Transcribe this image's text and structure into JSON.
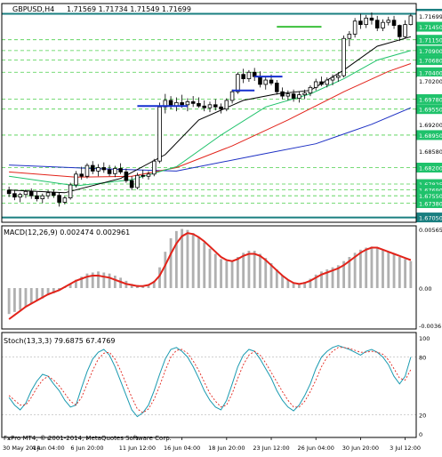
{
  "chart_data": {
    "type": "candlestick",
    "header": {
      "symbol": "GBPUSD,H4",
      "ohlc": "1.71569 1.71734 1.71549 1.71699"
    },
    "price_panel": {
      "ylim": [
        1.67,
        1.718
      ],
      "price_tags": [
        {
          "value": 1.7175,
          "label": "1.71750",
          "style": "teal"
        },
        {
          "value": 1.717,
          "label": "1.71699",
          "style": "current"
        },
        {
          "value": 1.7145,
          "label": "1.71450",
          "style": "green"
        },
        {
          "value": 1.7115,
          "label": "1.71150",
          "style": "green"
        },
        {
          "value": 1.709,
          "label": "1.70900",
          "style": "green"
        },
        {
          "value": 1.7068,
          "label": "1.70680",
          "style": "green"
        },
        {
          "value": 1.704,
          "label": "1.70400",
          "style": "green"
        },
        {
          "value": 1.702,
          "label": "1.70200",
          "style": "plain"
        },
        {
          "value": 1.6978,
          "label": "1.69780",
          "style": "green"
        },
        {
          "value": 1.6955,
          "label": "1.69550",
          "style": "green"
        },
        {
          "value": 1.692,
          "label": "1.69200",
          "style": "plain"
        },
        {
          "value": 1.6895,
          "label": "1.68950",
          "style": "green"
        },
        {
          "value": 1.6858,
          "label": "1.68580",
          "style": "plain"
        },
        {
          "value": 1.682,
          "label": "1.68200",
          "style": "green"
        },
        {
          "value": 1.6782,
          "label": "1.67825",
          "style": "green"
        },
        {
          "value": 1.6769,
          "label": "1.67690",
          "style": "green"
        },
        {
          "value": 1.6755,
          "label": "1.67550",
          "style": "green"
        },
        {
          "value": 1.6738,
          "label": "1.67380",
          "style": "green"
        },
        {
          "value": 1.6705,
          "label": "1.67050",
          "style": "teal"
        }
      ],
      "candles": [
        [
          1.6768,
          1.6776,
          1.6752,
          1.676
        ],
        [
          1.676,
          1.6768,
          1.6745,
          1.6752
        ],
        [
          1.6752,
          1.6762,
          1.674,
          1.6758
        ],
        [
          1.6758,
          1.677,
          1.675,
          1.6765
        ],
        [
          1.6765,
          1.6772,
          1.6748,
          1.6755
        ],
        [
          1.6755,
          1.6764,
          1.6742,
          1.6748
        ],
        [
          1.6748,
          1.676,
          1.6738,
          1.6755
        ],
        [
          1.6755,
          1.6768,
          1.6748,
          1.6762
        ],
        [
          1.6762,
          1.677,
          1.675,
          1.6756
        ],
        [
          1.6756,
          1.6762,
          1.673,
          1.674
        ],
        [
          1.674,
          1.6754,
          1.6735,
          1.675
        ],
        [
          1.675,
          1.6785,
          1.6746,
          1.678
        ],
        [
          1.678,
          1.6812,
          1.6774,
          1.6805
        ],
        [
          1.6805,
          1.6822,
          1.6792,
          1.68
        ],
        [
          1.68,
          1.683,
          1.6795,
          1.6825
        ],
        [
          1.6825,
          1.6835,
          1.6805,
          1.6812
        ],
        [
          1.6812,
          1.6828,
          1.68,
          1.682
        ],
        [
          1.682,
          1.6832,
          1.6808,
          1.6815
        ],
        [
          1.6815,
          1.6826,
          1.68,
          1.6806
        ],
        [
          1.6806,
          1.6824,
          1.6798,
          1.6818
        ],
        [
          1.6818,
          1.683,
          1.6805,
          1.681
        ],
        [
          1.681,
          1.6818,
          1.6785,
          1.679
        ],
        [
          1.679,
          1.68,
          1.6768,
          1.6774
        ],
        [
          1.6774,
          1.6808,
          1.677,
          1.6802
        ],
        [
          1.6802,
          1.6815,
          1.6795,
          1.68
        ],
        [
          1.68,
          1.6812,
          1.6792,
          1.6805
        ],
        [
          1.6805,
          1.684,
          1.68,
          1.6835
        ],
        [
          1.6835,
          1.697,
          1.683,
          1.696
        ],
        [
          1.696,
          1.699,
          1.6945,
          1.6975
        ],
        [
          1.6975,
          1.6985,
          1.6955,
          1.6962
        ],
        [
          1.6962,
          1.6982,
          1.695,
          1.697
        ],
        [
          1.697,
          1.6988,
          1.6958,
          1.6965
        ],
        [
          1.6965,
          1.698,
          1.695,
          1.6972
        ],
        [
          1.6972,
          1.6985,
          1.696,
          1.6968
        ],
        [
          1.6968,
          1.6982,
          1.6958,
          1.6962
        ],
        [
          1.6962,
          1.6975,
          1.695,
          1.6958
        ],
        [
          1.6958,
          1.6972,
          1.6948,
          1.6965
        ],
        [
          1.6965,
          1.6978,
          1.6952,
          1.696
        ],
        [
          1.696,
          1.6968,
          1.6945,
          1.6955
        ],
        [
          1.6955,
          1.698,
          1.695,
          1.6975
        ],
        [
          1.6975,
          1.7,
          1.6968,
          1.6995
        ],
        [
          1.6995,
          1.704,
          1.699,
          1.7035
        ],
        [
          1.7035,
          1.7048,
          1.7015,
          1.7025
        ],
        [
          1.7025,
          1.7045,
          1.7018,
          1.704
        ],
        [
          1.704,
          1.705,
          1.702,
          1.703
        ],
        [
          1.703,
          1.7042,
          1.7005,
          1.7012
        ],
        [
          1.7012,
          1.703,
          1.7,
          1.7022
        ],
        [
          1.7022,
          1.7035,
          1.701,
          1.7015
        ],
        [
          1.7015,
          1.7022,
          1.6988,
          1.6995
        ],
        [
          1.6995,
          1.7005,
          1.6978,
          1.6985
        ],
        [
          1.6985,
          1.6998,
          1.6975,
          1.699
        ],
        [
          1.699,
          1.7,
          1.6972,
          1.698
        ],
        [
          1.698,
          1.6995,
          1.697,
          1.6988
        ],
        [
          1.6988,
          1.7,
          1.6978,
          1.6992
        ],
        [
          1.6992,
          1.701,
          1.6985,
          1.7005
        ],
        [
          1.7005,
          1.7025,
          1.6998,
          1.7018
        ],
        [
          1.7018,
          1.703,
          1.7008,
          1.7012
        ],
        [
          1.7012,
          1.7028,
          1.7005,
          1.7022
        ],
        [
          1.7022,
          1.7035,
          1.701,
          1.7028
        ],
        [
          1.7028,
          1.704,
          1.7018,
          1.7032
        ],
        [
          1.7032,
          1.7125,
          1.7028,
          1.7118
        ],
        [
          1.7118,
          1.7135,
          1.71,
          1.7128
        ],
        [
          1.7128,
          1.7165,
          1.712,
          1.7158
        ],
        [
          1.7158,
          1.7175,
          1.714,
          1.715
        ],
        [
          1.715,
          1.7172,
          1.7142,
          1.7165
        ],
        [
          1.7165,
          1.7178,
          1.715,
          1.716
        ],
        [
          1.716,
          1.717,
          1.7135,
          1.7142
        ],
        [
          1.7142,
          1.7162,
          1.7135,
          1.7155
        ],
        [
          1.7155,
          1.7168,
          1.7148,
          1.716
        ],
        [
          1.716,
          1.717,
          1.714,
          1.7148
        ],
        [
          1.7148,
          1.715,
          1.7112,
          1.7122
        ],
        [
          1.7122,
          1.716,
          1.7118,
          1.715
        ],
        [
          1.715,
          1.7175,
          1.7148,
          1.717
        ]
      ],
      "moving_averages": [
        {
          "color": "#1c2fc4",
          "points": [
            [
              0,
              1.6826
            ],
            [
              15,
              1.6818
            ],
            [
              30,
              1.6812
            ],
            [
              45,
              1.685
            ],
            [
              55,
              1.6875
            ],
            [
              65,
              1.692
            ],
            [
              72,
              1.6958
            ]
          ]
        },
        {
          "color": "#e2231a",
          "points": [
            [
              0,
              1.681
            ],
            [
              12,
              1.6798
            ],
            [
              22,
              1.68
            ],
            [
              30,
              1.682
            ],
            [
              40,
              1.687
            ],
            [
              50,
              1.693
            ],
            [
              60,
              1.6995
            ],
            [
              68,
              1.7042
            ],
            [
              72,
              1.706
            ]
          ]
        },
        {
          "color": "#1fc26b",
          "points": [
            [
              0,
              1.68
            ],
            [
              12,
              1.6778
            ],
            [
              22,
              1.6792
            ],
            [
              30,
              1.6822
            ],
            [
              38,
              1.6895
            ],
            [
              46,
              1.696
            ],
            [
              54,
              1.699
            ],
            [
              60,
              1.7025
            ],
            [
              66,
              1.7068
            ],
            [
              72,
              1.709
            ]
          ]
        },
        {
          "color": "#000000",
          "points": [
            [
              0,
              1.6768
            ],
            [
              10,
              1.6762
            ],
            [
              20,
              1.6795
            ],
            [
              28,
              1.685
            ],
            [
              34,
              1.693
            ],
            [
              42,
              1.6975
            ],
            [
              48,
              1.699
            ],
            [
              54,
              1.6998
            ],
            [
              60,
              1.7045
            ],
            [
              66,
              1.71
            ],
            [
              72,
              1.7122
            ]
          ]
        }
      ],
      "levels": [
        {
          "value": 1.6962,
          "from": 23,
          "to": 32,
          "color": "#1530d0"
        },
        {
          "value": 1.6998,
          "from": 40,
          "to": 44,
          "color": "#1530d0"
        },
        {
          "value": 1.703,
          "from": 44,
          "to": 49,
          "color": "#1530d0"
        },
        {
          "value": 1.7145,
          "from": 48,
          "to": 56,
          "color": "#3cc03c"
        }
      ],
      "dashed_levels": [
        1.7115,
        1.709,
        1.7068,
        1.704,
        1.6978,
        1.6955,
        1.6895,
        1.682,
        1.6782,
        1.6769,
        1.6755,
        1.6738
      ]
    },
    "macd_panel": {
      "label": "MACD(12,26,9) 0.002474 0.002961",
      "ylim": [
        -0.0036,
        0.005657
      ],
      "tick_labels": [
        "0.005657",
        "0.00",
        "-0.0036"
      ],
      "tick_values": [
        0.005657,
        0.0,
        -0.0036
      ],
      "histogram": [
        -0.0025,
        -0.0023,
        -0.0021,
        -0.0018,
        -0.0015,
        -0.0012,
        -0.001,
        -0.0007,
        -0.0005,
        -0.0002,
        0.0001,
        0.0004,
        0.0008,
        0.0011,
        0.0014,
        0.0015,
        0.0016,
        0.0015,
        0.0014,
        0.0012,
        0.001,
        0.0007,
        0.0004,
        0.0003,
        0.0002,
        0.0003,
        0.0007,
        0.002,
        0.0035,
        0.0048,
        0.0055,
        0.0057,
        0.0056,
        0.0053,
        0.0049,
        0.0044,
        0.0038,
        0.0033,
        0.0028,
        0.0026,
        0.0026,
        0.003,
        0.0034,
        0.0036,
        0.0036,
        0.0033,
        0.0029,
        0.0024,
        0.0018,
        0.0012,
        0.0008,
        0.0005,
        0.0004,
        0.0006,
        0.0009,
        0.0013,
        0.0016,
        0.0018,
        0.002,
        0.0022,
        0.0026,
        0.003,
        0.0034,
        0.0037,
        0.0039,
        0.004,
        0.0039,
        0.0037,
        0.0035,
        0.0033,
        0.003,
        0.0028,
        0.0026
      ],
      "signal": [
        -0.003,
        -0.0026,
        -0.0022,
        -0.0018,
        -0.0015,
        -0.0012,
        -0.0009,
        -0.0006,
        -0.0004,
        -0.0002,
        0.0001,
        0.0004,
        0.0007,
        0.0009,
        0.0011,
        0.0012,
        0.0012,
        0.0011,
        0.001,
        0.0008,
        0.0006,
        0.0004,
        0.0003,
        0.0002,
        0.0002,
        0.0003,
        0.0006,
        0.0012,
        0.0022,
        0.0033,
        0.0043,
        0.005,
        0.0053,
        0.0052,
        0.0049,
        0.0045,
        0.004,
        0.0035,
        0.003,
        0.0027,
        0.0026,
        0.0028,
        0.0031,
        0.0033,
        0.0033,
        0.0031,
        0.0027,
        0.0022,
        0.0017,
        0.0012,
        0.0008,
        0.0005,
        0.0004,
        0.0005,
        0.0007,
        0.001,
        0.0013,
        0.0015,
        0.0017,
        0.0019,
        0.0022,
        0.0026,
        0.003,
        0.0034,
        0.0037,
        0.0039,
        0.0039,
        0.0037,
        0.0035,
        0.0033,
        0.0031,
        0.0029,
        0.0027
      ]
    },
    "stoch_panel": {
      "label": "Stoch(13,3,3) 79.6875 67.4769",
      "ylim": [
        0,
        100
      ],
      "tick_labels": [
        "100",
        "80",
        "20",
        "0"
      ],
      "tick_values": [
        100,
        80,
        20,
        0
      ],
      "main": [
        38,
        30,
        25,
        32,
        45,
        55,
        62,
        60,
        52,
        45,
        35,
        28,
        30,
        48,
        65,
        78,
        85,
        88,
        82,
        70,
        55,
        40,
        25,
        18,
        22,
        30,
        45,
        62,
        78,
        88,
        90,
        86,
        80,
        70,
        58,
        45,
        35,
        28,
        25,
        35,
        52,
        70,
        82,
        88,
        86,
        78,
        68,
        58,
        45,
        35,
        28,
        24,
        30,
        40,
        52,
        68,
        80,
        86,
        90,
        92,
        90,
        88,
        85,
        82,
        86,
        88,
        85,
        80,
        72,
        60,
        52,
        60,
        80
      ],
      "signal": [
        40,
        35,
        30,
        30,
        38,
        48,
        56,
        60,
        56,
        50,
        42,
        34,
        30,
        38,
        52,
        66,
        78,
        84,
        85,
        78,
        66,
        52,
        38,
        26,
        22,
        26,
        36,
        50,
        66,
        80,
        87,
        88,
        84,
        76,
        66,
        54,
        42,
        34,
        28,
        30,
        42,
        58,
        72,
        82,
        86,
        82,
        74,
        64,
        54,
        44,
        35,
        28,
        28,
        34,
        44,
        56,
        70,
        80,
        86,
        90,
        90,
        89,
        87,
        85,
        85,
        86,
        85,
        83,
        77,
        68,
        58,
        56,
        67
      ]
    },
    "x_axis": {
      "labels": [
        {
          "index": 0,
          "text": "30 May 2014"
        },
        {
          "index": 7,
          "text": "4 Jun 04:00"
        },
        {
          "index": 14,
          "text": "6 Jun 20:00"
        },
        {
          "index": 23,
          "text": "11 Jun 12:00"
        },
        {
          "index": 31,
          "text": "16 Jun 04:00"
        },
        {
          "index": 39,
          "text": "18 Jun 20:00"
        },
        {
          "index": 47,
          "text": "23 Jun 12:00"
        },
        {
          "index": 55,
          "text": "26 Jun 04:00"
        },
        {
          "index": 63,
          "text": "30 Jun 20:00"
        },
        {
          "index": 71,
          "text": "3 Jul 12:00"
        }
      ]
    },
    "footer": "FxPro MT4, © 2001-2014, MetaQuotes Software Corp.",
    "colors": {
      "bull": "#000000",
      "bear": "#000000",
      "grid": "#c0c0c0",
      "price_tag_green": "#1fc26b",
      "price_tag_teal": "#1a7f80",
      "macd_line": "#e2231a",
      "hist": "#b0b0b0"
    }
  }
}
